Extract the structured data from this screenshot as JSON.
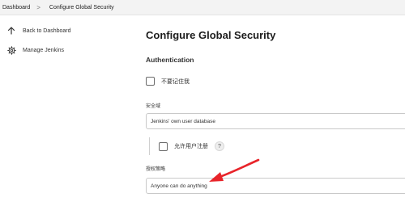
{
  "breadcrumb": {
    "items": [
      "Dashboard",
      "Configure Global Security"
    ],
    "separator": ">"
  },
  "sidebar": {
    "items": [
      {
        "label": "Back to Dashboard",
        "icon": "arrow-up-icon"
      },
      {
        "label": "Manage Jenkins",
        "icon": "gear-icon"
      }
    ]
  },
  "main": {
    "title": "Configure Global Security",
    "section_title": "Authentication",
    "remember_me_label": "不要记住我",
    "security_realm_label": "安全域",
    "security_realm_value": "Jenkins' own user database",
    "allow_signup_label": "允许用户注册",
    "help_label": "?",
    "authorization_label": "授权策略",
    "authorization_value": "Anyone can do anything"
  },
  "annotation": {
    "arrow_color": "#e8242a"
  }
}
